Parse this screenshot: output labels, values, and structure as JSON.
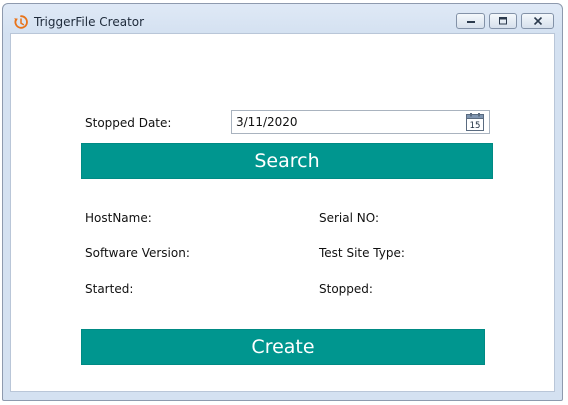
{
  "window": {
    "title": "TriggerFile Creator",
    "icon": "trigger-app-icon",
    "controls": [
      "minimize-icon",
      "maximize-icon",
      "close-icon"
    ]
  },
  "form": {
    "stopped_date_label": "Stopped Date:",
    "stopped_date_value": "3/11/2020",
    "calendar_icon_day": "15",
    "search_label": "Search",
    "create_label": "Create"
  },
  "info": {
    "hostname_label": "HostName:",
    "serial_label": "Serial NO:",
    "software_version_label": "Software Version:",
    "test_site_type_label": "Test Site Type:",
    "started_label": "Started:",
    "stopped_label": "Stopped:"
  },
  "colors": {
    "accent": "#00968F",
    "title_bar": "#DCE6F4",
    "app_icon": "#E8731A"
  }
}
